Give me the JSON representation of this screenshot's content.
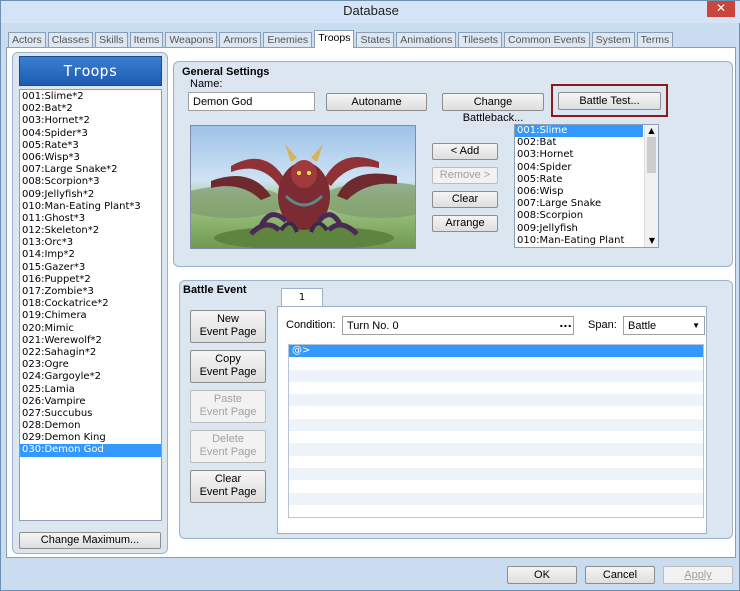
{
  "window": {
    "title": "Database",
    "close": "✕"
  },
  "tabs": [
    "Actors",
    "Classes",
    "Skills",
    "Items",
    "Weapons",
    "Armors",
    "Enemies",
    "Troops",
    "States",
    "Animations",
    "Tilesets",
    "Common Events",
    "System",
    "Terms"
  ],
  "active_tab": 7,
  "troops_panel": {
    "title": "Troops",
    "items": [
      "001:Slime*2",
      "002:Bat*2",
      "003:Hornet*2",
      "004:Spider*3",
      "005:Rate*3",
      "006:Wisp*3",
      "007:Large Snake*2",
      "008:Scorpion*3",
      "009:Jellyfish*2",
      "010:Man-Eating Plant*3",
      "011:Ghost*3",
      "012:Skeleton*2",
      "013:Orc*3",
      "014:Imp*2",
      "015:Gazer*3",
      "016:Puppet*2",
      "017:Zombie*3",
      "018:Cockatrice*2",
      "019:Chimera",
      "020:Mimic",
      "021:Werewolf*2",
      "022:Sahagin*2",
      "023:Ogre",
      "024:Gargoyle*2",
      "025:Lamia",
      "026:Vampire",
      "027:Succubus",
      "028:Demon",
      "029:Demon King",
      "030:Demon God"
    ],
    "selected": 29,
    "change_max": "Change Maximum..."
  },
  "general": {
    "title": "General Settings",
    "name_label": "Name:",
    "name_value": "Demon God",
    "autoname": "Autoname",
    "change_battleback": "Change Battleback...",
    "battle_test": "Battle Test...",
    "add": "< Add",
    "remove": "Remove >",
    "clear": "Clear",
    "arrange": "Arrange",
    "enemies": [
      "001:Slime",
      "002:Bat",
      "003:Hornet",
      "004:Spider",
      "005:Rate",
      "006:Wisp",
      "007:Large Snake",
      "008:Scorpion",
      "009:Jellyfish",
      "010:Man-Eating Plant"
    ],
    "enemy_selected": 0
  },
  "battle_event": {
    "title": "Battle Event",
    "page_tab": "1",
    "new_page": [
      "New",
      "Event Page"
    ],
    "copy_page": [
      "Copy",
      "Event Page"
    ],
    "paste_page": [
      "Paste",
      "Event Page"
    ],
    "delete_page": [
      "Delete",
      "Event Page"
    ],
    "clear_page": [
      "Clear",
      "Event Page"
    ],
    "condition_label": "Condition:",
    "condition_value": "Turn No. 0",
    "condition_btn": "...",
    "span_label": "Span:",
    "span_value": "Battle",
    "commands": [
      "@>"
    ]
  },
  "footer": {
    "ok": "OK",
    "cancel": "Cancel",
    "apply": "Apply"
  },
  "colors": {
    "selection": "#3399ff",
    "highlight_border": "#8b1a1a"
  }
}
